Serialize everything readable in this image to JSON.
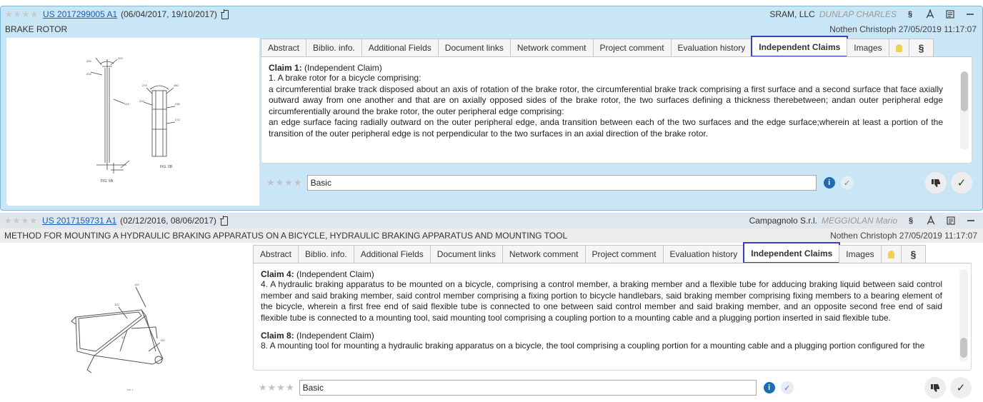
{
  "cards": [
    {
      "rating": "★★★★",
      "patent_number": "US 2017299005 A1",
      "dates": "(06/04/2017, 19/10/2017)",
      "company": "SRAM, LLC",
      "inventor": "DUNLAP CHARLES",
      "title": "BRAKE ROTOR",
      "owner": "Nothen Christoph 27/05/2019 11:17:07",
      "figure_labels": [
        "FIG. 6A",
        "FIG. 6B"
      ],
      "claims": [
        {
          "head": "Claim 1:",
          "tag": "(Independent Claim)",
          "lines": [
            "1. A brake rotor for a bicycle comprising:",
            "a circumferential brake track disposed about an axis of rotation of the brake rotor, the circumferential brake track comprising a first surface and a second surface that face axially outward away from one another and that are on axially opposed sides of the brake rotor, the two surfaces defining a thickness therebetween; andan outer peripheral edge circumferentially around the brake rotor, the outer peripheral edge comprising:",
            "an edge surface facing radially outward on the outer peripheral edge, anda transition between each of the two surfaces and the edge surface;wherein at least a portion of the transition of the outer peripheral edge is not perpendicular to the two surfaces in an axial direction of the brake rotor."
          ]
        }
      ],
      "comment_rating": "★★★★",
      "comment_value": "Basic"
    },
    {
      "rating": "★★★★",
      "patent_number": "US 2017159731 A1",
      "dates": "(02/12/2016, 08/06/2017)",
      "company": "Campagnolo S.r.l.",
      "inventor": "MEGGIOLAN Mario",
      "title": "METHOD FOR MOUNTING A HYDRAULIC BRAKING APPARATUS ON A BICYCLE, HYDRAULIC BRAKING APPARATUS AND MOUNTING TOOL",
      "owner": "Nothen Christoph 27/05/2019 11:17:07",
      "claims": [
        {
          "head": "Claim 4:",
          "tag": "(Independent Claim)",
          "lines": [
            "4. A hydraulic braking apparatus to be mounted on a bicycle, comprising a control member, a braking member and a flexible tube for adducing braking liquid between said control member and said braking member, said control member comprising a fixing portion to bicycle handlebars, said braking member comprising fixing members to a bearing element of the bicycle, wherein a first free end of said flexible tube is connected to one between said control member and said braking member, and an opposite second free end of said flexible tube is connected to a mounting tool, said mounting tool comprising a coupling portion to a mounting cable and a plugging portion inserted in said flexible tube."
          ]
        },
        {
          "head": "Claim 8:",
          "tag": "(Independent Claim)",
          "lines": [
            "8. A mounting tool for mounting a hydraulic braking apparatus on a bicycle, the tool comprising a coupling portion for a mounting cable and a plugging portion configured for the"
          ]
        }
      ],
      "comment_rating": "★★★★",
      "comment_value": "Basic"
    }
  ],
  "tabs": [
    "Abstract",
    "Biblio. info.",
    "Additional Fields",
    "Document links",
    "Network comment",
    "Project comment",
    "Evaluation history",
    "Independent Claims",
    "Images"
  ],
  "active_tab": "Independent Claims",
  "icons": {
    "section": "§",
    "pdf": "pdf-icon",
    "notes": "notes-icon",
    "collapse": "minus-icon",
    "bulb": "bulb-icon",
    "info": "i",
    "check": "✓",
    "thumbs_down": "thumbs-down-icon"
  },
  "colors": {
    "selected_card_bg": "#c9e6f6",
    "active_tab_outline": "#3b3fc4",
    "link": "#1a5fb4",
    "info": "#1b6bb5"
  }
}
